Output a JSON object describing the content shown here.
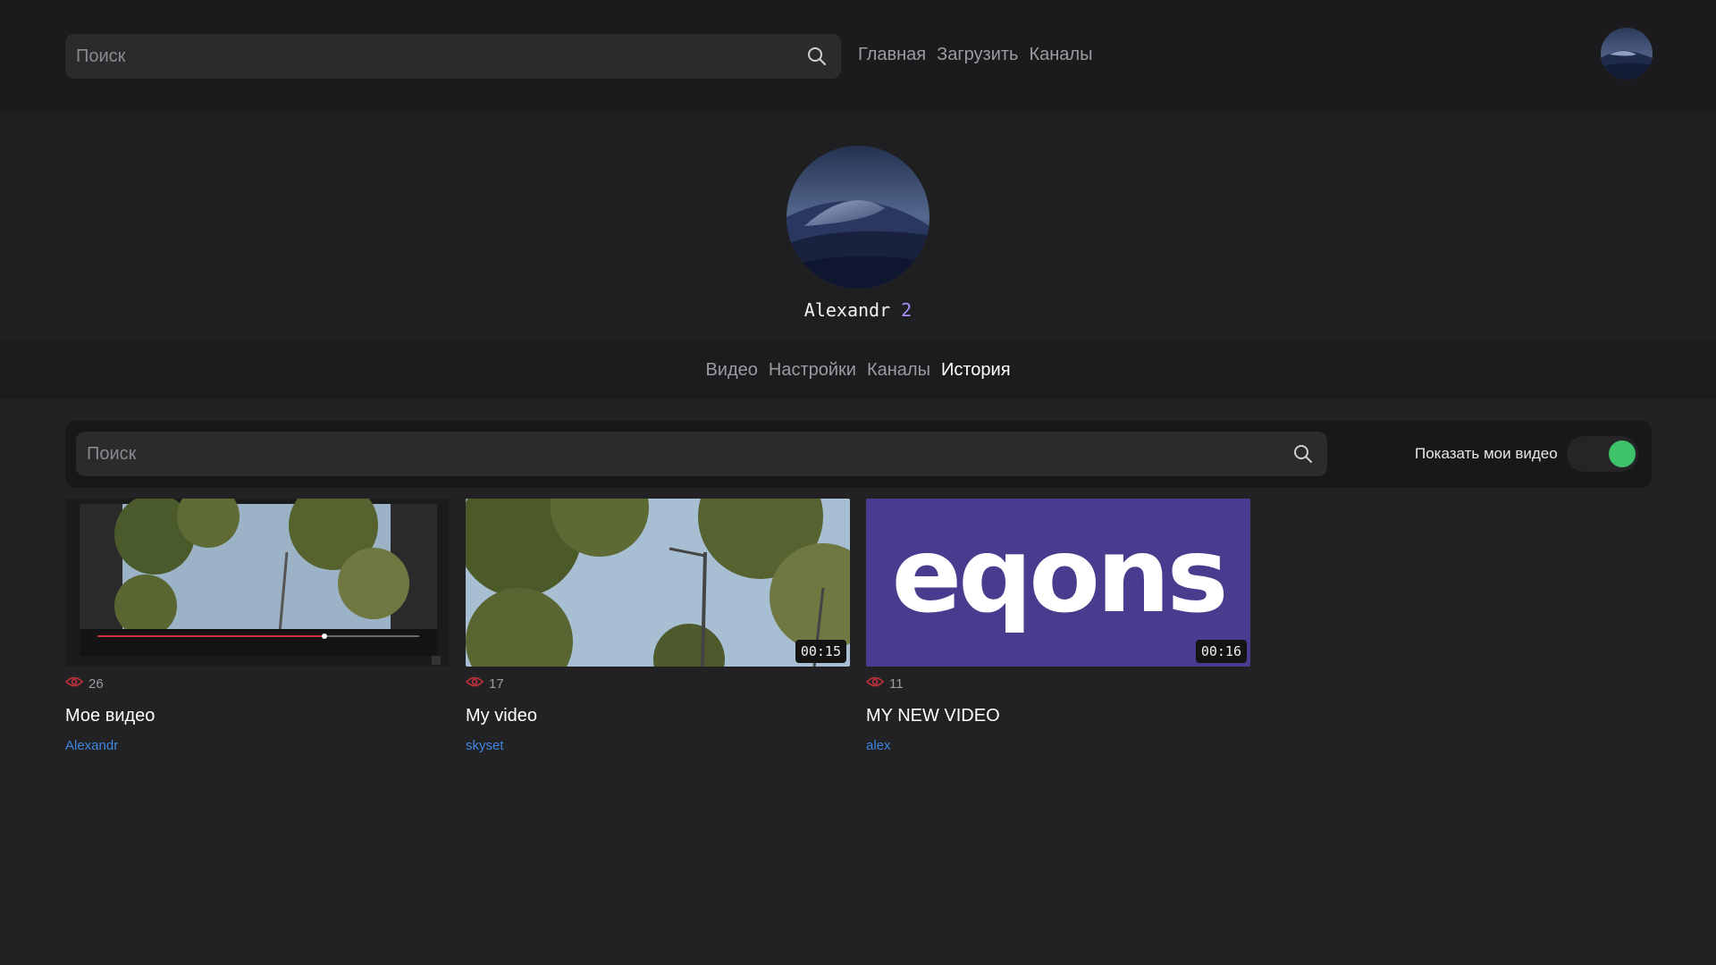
{
  "header": {
    "search_placeholder": "Поиск",
    "nav": [
      "Главная",
      "Загрузить",
      "Каналы"
    ]
  },
  "profile": {
    "name": "Alexandr",
    "count": "2"
  },
  "tabs": [
    "Видео",
    "Настройки",
    "Каналы",
    "История"
  ],
  "active_tab": "История",
  "history": {
    "search_placeholder": "Поиск",
    "toggle_label": "Показать мои видео",
    "toggle_on": true,
    "toggle_color": "#3ec26a"
  },
  "videos": [
    {
      "views": "26",
      "title": "Мое видео",
      "author": "Alexandr",
      "duration": ""
    },
    {
      "views": "17",
      "title": "My video",
      "author": "skyset",
      "duration": "00:15"
    },
    {
      "views": "11",
      "title": "MY NEW VIDEO",
      "author": "alex",
      "duration": "00:16"
    }
  ],
  "thumb3_text": "eqons",
  "colors": {
    "accent_link": "#3f86e0",
    "views_icon": "#c0303a",
    "count_accent": "#a98df0"
  }
}
